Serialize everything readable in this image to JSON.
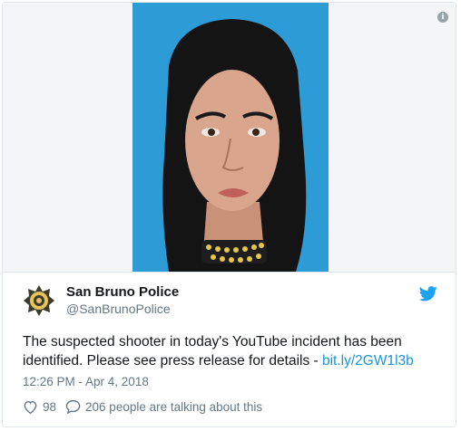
{
  "tweet": {
    "display_name": "San Bruno Police",
    "handle": "@SanBrunoPolice",
    "text": "The suspected shooter in today's YouTube incident has been identified. Please see press release for details - ",
    "link_text": "bit.ly/2GW1l3b",
    "timestamp": "12:26 PM - Apr 4, 2018",
    "likes": "98",
    "conversation": "206 people are talking about this"
  },
  "icons": {
    "info": "info-icon",
    "twitter": "twitter-bird-icon",
    "like": "heart-icon",
    "reply": "speech-bubble-icon",
    "avatar": "police-badge-icon"
  },
  "colors": {
    "photo_background": "#2c9bd6",
    "link": "#1b95e0",
    "twitter_blue": "#1da1f2",
    "muted_text": "#657786"
  }
}
